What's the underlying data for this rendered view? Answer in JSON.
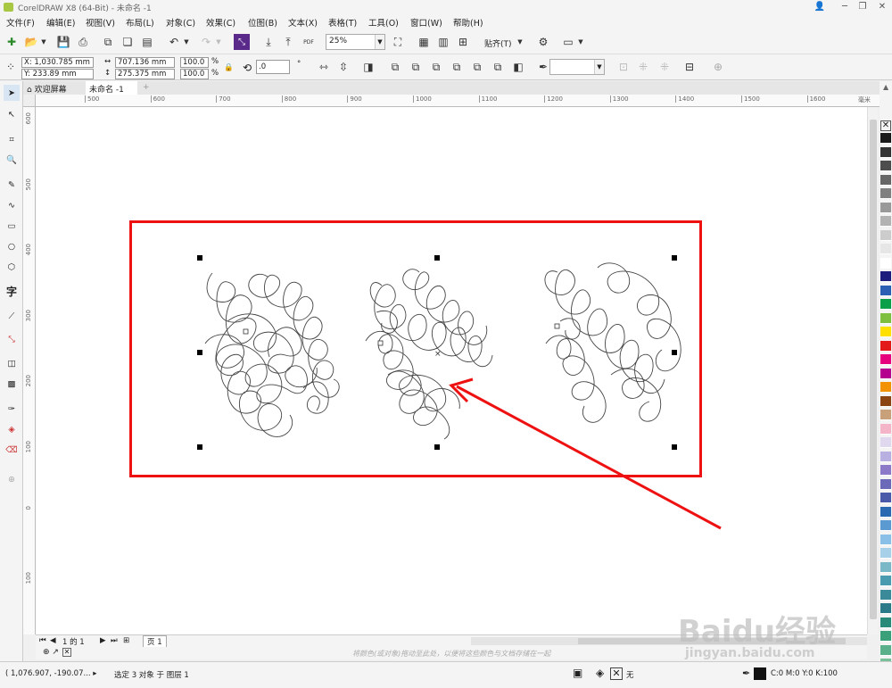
{
  "window": {
    "title": "CorelDRAW X8 (64-Bit) - 未命名 -1"
  },
  "menu": [
    "文件(F)",
    "编辑(E)",
    "视图(V)",
    "布局(L)",
    "对象(C)",
    "效果(C)",
    "位图(B)",
    "文本(X)",
    "表格(T)",
    "工具(O)",
    "窗口(W)",
    "帮助(H)"
  ],
  "toolbar": {
    "zoom": "25%",
    "snap_label": "贴齐(T)",
    "pdf_label": "PDF"
  },
  "props": {
    "x": "X: 1,030.785 mm",
    "y": "Y: 233.89 mm",
    "width": "707.136 mm",
    "height": "275.375 mm",
    "scale_w": "100.0",
    "scale_h": "100.0",
    "pct": "%",
    "angle": ".0",
    "deg": "°"
  },
  "tabs": {
    "welcome": "欢迎屏幕",
    "doc": "未命名 -1"
  },
  "rulers": {
    "h_ticks": [
      "500",
      "600",
      "700",
      "800",
      "900",
      "1000",
      "1100",
      "1200",
      "1300",
      "1400",
      "1500",
      "1600"
    ],
    "h_unit": "毫米",
    "v_ticks": [
      "600",
      "500",
      "400",
      "300",
      "200",
      "100",
      "0",
      "100"
    ]
  },
  "pagebar": {
    "page_count": "1 的 1",
    "page_tab": "页 1"
  },
  "hint": "将颜色(或对象)拖动至此处，以便将这些颜色与文档存储在一起",
  "status": {
    "coords": "( 1,076.907, -190.07... ▸",
    "selection": "选定 3 对象 于 图层 1",
    "fill": "无",
    "color": "C:0 M:0 Y:0 K:100"
  },
  "watermark": {
    "line1": "Baidu经验",
    "line2": "jingyan.baidu.com"
  },
  "palette_colors": [
    "#1a1a1a",
    "#333333",
    "#4d4d4d",
    "#666666",
    "#808080",
    "#999999",
    "#b3b3b3",
    "#cccccc",
    "#e6e6e6",
    "#ffffff",
    "#1c1c7c",
    "#2b5fb4",
    "#0aa04a",
    "#7fbf3f",
    "#ffe000",
    "#e21a1a",
    "#e6007e",
    "#b5008f",
    "#f39200",
    "#8b4513",
    "#c8a07a",
    "#f5b5c8",
    "#e0d8ee",
    "#b8b0e0",
    "#8c7ac8",
    "#6a6ab8",
    "#4a5aa8",
    "#2b6ab0",
    "#5a9ad0",
    "#8ac0e8",
    "#a8d0e8",
    "#7ab8c8",
    "#4a9ab0",
    "#3a8a9a",
    "#2a7a8a",
    "#2a8a7a",
    "#3aa07a",
    "#5ab08a",
    "#7ac09a",
    "#2a9aa0"
  ]
}
